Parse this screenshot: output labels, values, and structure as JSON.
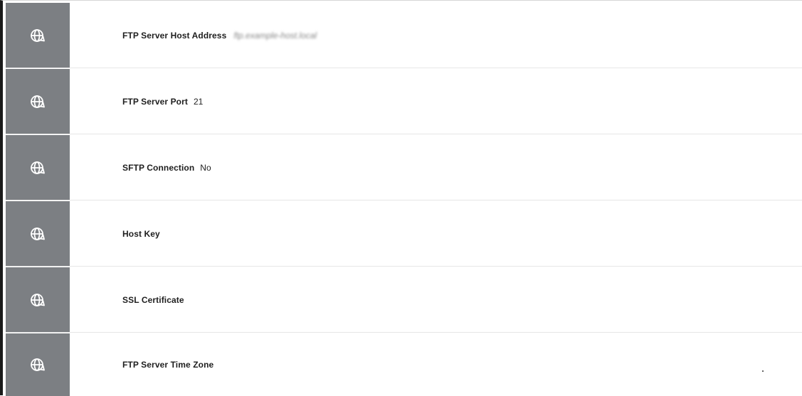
{
  "settings": {
    "rows": [
      {
        "label": "FTP Server Host Address",
        "value": "ftp.example-host.local",
        "value_obscured": true,
        "icon": "sync-globe-icon"
      },
      {
        "label": "FTP Server Port",
        "value": "21",
        "value_obscured": false,
        "icon": "sync-globe-icon"
      },
      {
        "label": "SFTP Connection",
        "value": "No",
        "value_obscured": false,
        "icon": "sync-globe-icon"
      },
      {
        "label": "Host Key",
        "value": "",
        "value_obscured": false,
        "icon": "sync-globe-icon"
      },
      {
        "label": "SSL Certificate",
        "value": "",
        "value_obscured": false,
        "icon": "sync-globe-icon"
      },
      {
        "label": "FTP Server Time Zone",
        "value": "",
        "value_obscured": false,
        "icon": "sync-globe-icon"
      }
    ]
  },
  "colors": {
    "tile_background": "#7c7f83",
    "icon_stroke": "#ffffff",
    "row_divider": "#e6e6e6",
    "frame_border": "#1a1a1a"
  }
}
